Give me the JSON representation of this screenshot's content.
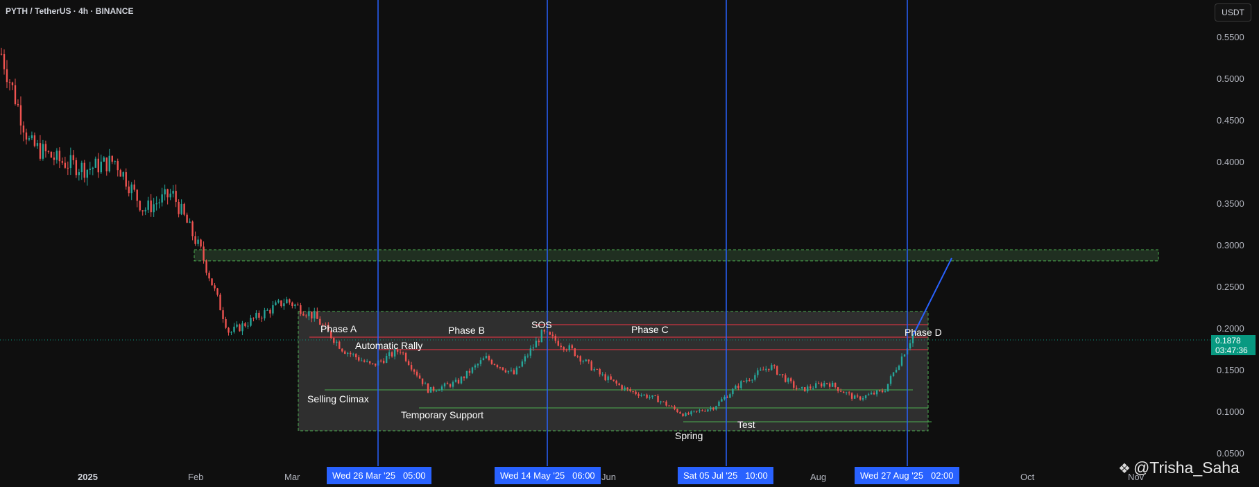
{
  "header": {
    "title": "PYTH / TetherUS · 4h · BINANCE"
  },
  "currency_button": "USDT",
  "price_axis": [
    "0.5500",
    "0.5000",
    "0.4500",
    "0.4000",
    "0.3500",
    "0.3000",
    "0.2500",
    "0.2000",
    "0.1500",
    "0.1000",
    "0.0500"
  ],
  "time_axis": [
    "2025",
    "Feb",
    "Mar",
    "Jun",
    "Aug",
    "Oct",
    "Nov"
  ],
  "date_markers": [
    "Wed 26 Mar '25   05:00",
    "Wed 14 May '25   06:00",
    "Sat 05 Jul '25   10:00",
    "Wed 27 Aug '25   02:00"
  ],
  "current_price": {
    "value": "0.1878",
    "countdown": "03:47:36"
  },
  "annotations": {
    "phase_a": "Phase A",
    "phase_b": "Phase B",
    "phase_c": "Phase C",
    "phase_d": "Phase D",
    "sos": "SOS",
    "automatic_rally": "Automatic Rally",
    "selling_climax": "Selling Climax",
    "temporary_support": "Temporary Support",
    "spring": "Spring",
    "test": "Test"
  },
  "watermark": "@Trisha_Saha",
  "colors": {
    "background": "#0f0f0f",
    "up_candle": "#26a69a",
    "down_candle": "#ef5350",
    "marker_line": "#2962ff",
    "resistance_line": "#f23645",
    "support_line": "#4caf50",
    "price_badge": "#089981"
  },
  "chart_data": {
    "type": "candlestick",
    "symbol": "PYTH / TetherUS",
    "interval": "4h",
    "exchange": "BINANCE",
    "y_range": [
      0.05,
      0.55
    ],
    "approx_close_path": [
      [
        "Jan",
        0.53
      ],
      [
        "Jan",
        0.42
      ],
      [
        "Jan",
        0.4
      ],
      [
        "Jan",
        0.39
      ],
      [
        "Jan",
        0.4
      ],
      [
        "Jan",
        0.34
      ],
      [
        "Jan",
        0.36
      ],
      [
        "Feb",
        0.29
      ],
      [
        "Feb",
        0.19
      ],
      [
        "Feb",
        0.21
      ],
      [
        "Feb",
        0.23
      ],
      [
        "Mar",
        0.21
      ],
      [
        "Mar",
        0.17
      ],
      [
        "Mar",
        0.15
      ],
      [
        "Mar",
        0.17
      ],
      [
        "Apr",
        0.12
      ],
      [
        "Apr",
        0.13
      ],
      [
        "May",
        0.16
      ],
      [
        "May",
        0.14
      ],
      [
        "May",
        0.19
      ],
      [
        "May",
        0.17
      ],
      [
        "Jun",
        0.14
      ],
      [
        "Jun",
        0.12
      ],
      [
        "Jun",
        0.11
      ],
      [
        "Jul",
        0.09
      ],
      [
        "Jul",
        0.1
      ],
      [
        "Jul",
        0.13
      ],
      [
        "Jul",
        0.15
      ],
      [
        "Aug",
        0.12
      ],
      [
        "Aug",
        0.13
      ],
      [
        "Aug",
        0.11
      ],
      [
        "Aug",
        0.12
      ],
      [
        "Aug",
        0.1878
      ]
    ],
    "levels": {
      "target_zone": [
        0.285,
        0.298
      ],
      "range_box": [
        0.08,
        0.22
      ],
      "resistance_lines": [
        0.205,
        0.192,
        0.176
      ],
      "support_lines": [
        0.127,
        0.105,
        0.088
      ],
      "current_price": 0.1878
    }
  }
}
